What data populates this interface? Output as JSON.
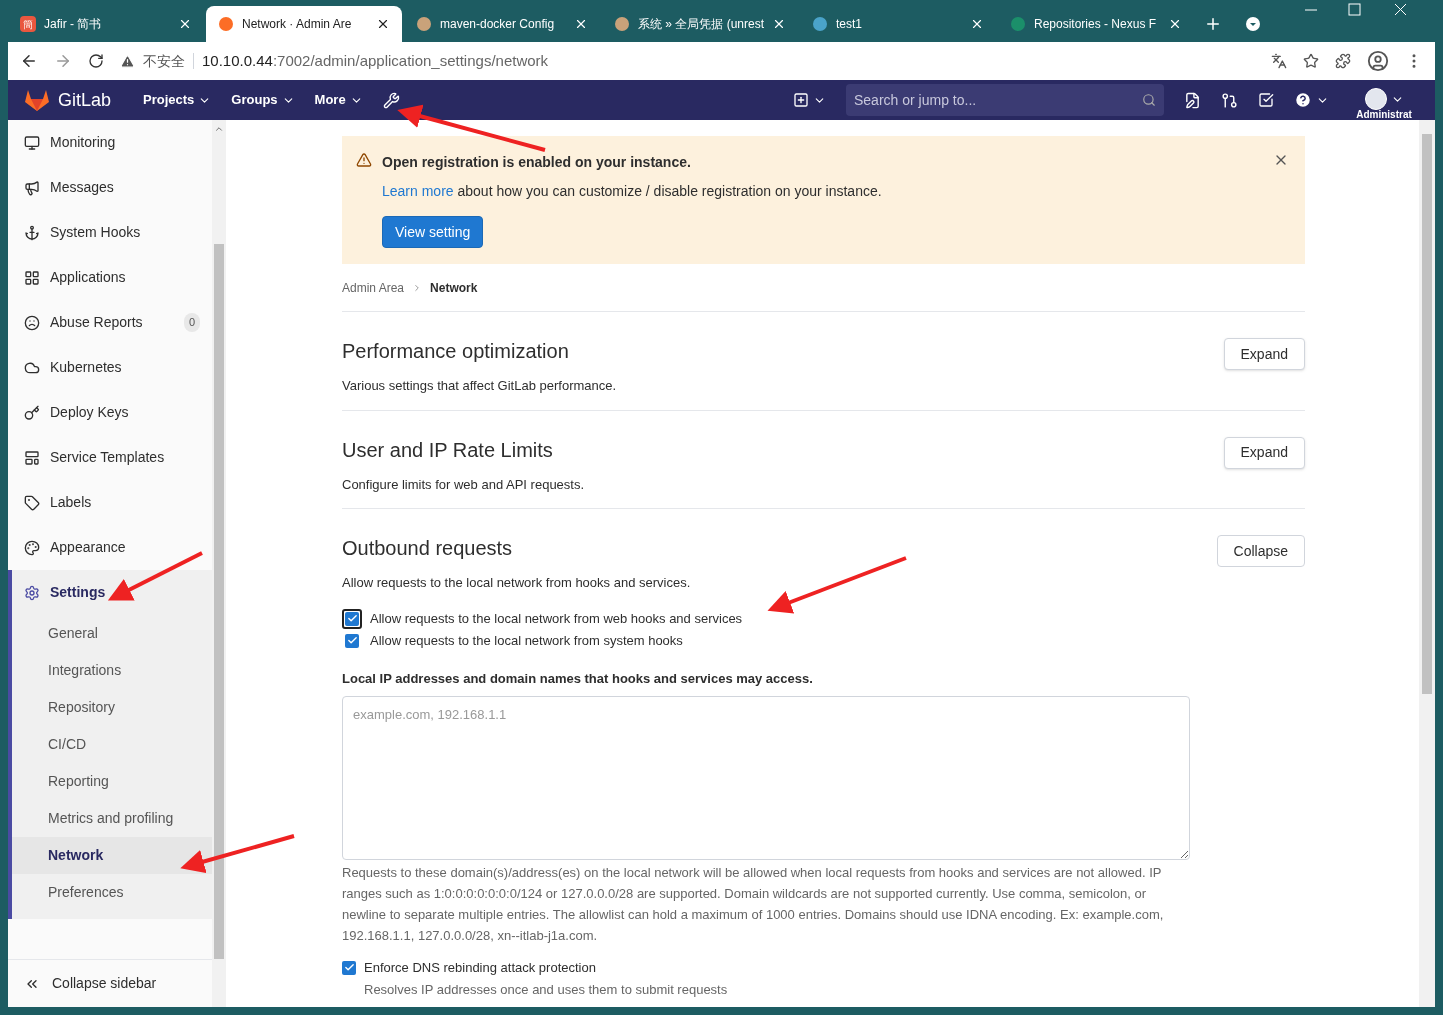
{
  "browser": {
    "tabs": [
      {
        "icon_text": "簡",
        "title": "Jafir - 简书",
        "selected": false
      },
      {
        "title": "Network · Admin Are",
        "selected": true
      },
      {
        "title": "maven-docker Config",
        "selected": false
      },
      {
        "title": "系统 » 全局凭据 (unrest",
        "selected": false
      },
      {
        "title": "test1",
        "selected": false
      },
      {
        "title": "Repositories - Nexus F",
        "selected": false
      }
    ],
    "security_label": "不安全",
    "url_host": "10.10.0.44",
    "url_path": ":7002/admin/application_settings/network"
  },
  "navbar": {
    "brand": "GitLab",
    "menus": [
      "Projects",
      "Groups",
      "More"
    ],
    "search": {
      "placeholder": "Search or jump to..."
    },
    "user_label": "Administrat"
  },
  "sidebar": {
    "items": [
      {
        "label": "Monitoring",
        "selected": false
      },
      {
        "label": "Messages",
        "selected": false
      },
      {
        "label": "System Hooks",
        "selected": false
      },
      {
        "label": "Applications",
        "selected": false
      },
      {
        "label": "Abuse Reports",
        "badge": "0",
        "selected": false
      },
      {
        "label": "Kubernetes",
        "selected": false
      },
      {
        "label": "Deploy Keys",
        "selected": false
      },
      {
        "label": "Service Templates",
        "selected": false
      },
      {
        "label": "Labels",
        "selected": false
      },
      {
        "label": "Appearance",
        "selected": false
      },
      {
        "label": "Settings",
        "selected": true,
        "expanded": true,
        "children": [
          {
            "label": "General",
            "selected": false
          },
          {
            "label": "Integrations",
            "selected": false
          },
          {
            "label": "Repository",
            "selected": false
          },
          {
            "label": "CI/CD",
            "selected": false
          },
          {
            "label": "Reporting",
            "selected": false
          },
          {
            "label": "Metrics and profiling",
            "selected": false
          },
          {
            "label": "Network",
            "selected": true
          },
          {
            "label": "Preferences",
            "selected": false
          }
        ]
      }
    ],
    "collapse_label": "Collapse sidebar"
  },
  "alert": {
    "title": "Open registration is enabled on your instance.",
    "link": "Learn more",
    "text": "about how you can customize / disable registration on your instance.",
    "button": "View setting"
  },
  "breadcrumbs": [
    "Admin Area",
    "Network"
  ],
  "sections": [
    {
      "title": "Performance optimization",
      "description": "Various settings that affect GitLab performance.",
      "button": "Expand",
      "expanded": false
    },
    {
      "title": "User and IP Rate Limits",
      "description": "Configure limits for web and API requests.",
      "button": "Expand",
      "expanded": false
    },
    {
      "title": "Outbound requests",
      "description": "Allow requests to the local network from hooks and services.",
      "button": "Collapse",
      "expanded": true
    }
  ],
  "outbound": {
    "checkboxes": [
      {
        "label": "Allow requests to the local network from web hooks and services",
        "checked": true,
        "focused": true
      },
      {
        "label": "Allow requests to the local network from system hooks",
        "checked": true,
        "focused": false
      }
    ],
    "field_label": "Local IP addresses and domain names that hooks and services may access.",
    "textarea": {
      "placeholder": "example.com, 192.168.1.1"
    },
    "help": "Requests to these domain(s)/address(es) on the local network will be allowed when local requests from hooks and services are not allowed. IP ranges such as 1:0:0:0:0:0:0:0/124 or 127.0.0.0/28 are supported. Domain wildcards are not supported currently. Use comma, semicolon, or newline to separate multiple entries. The allowlist can hold a maximum of 1000 entries. Domains should use IDNA encoding. Ex: example.com, 192.168.1.1, 127.0.0.0/28, xn--itlab-j1a.com.",
    "dns": {
      "label": "Enforce DNS rebinding attack protection",
      "checked": true,
      "hint": "Resolves IP addresses once and uses them to submit requests"
    }
  }
}
